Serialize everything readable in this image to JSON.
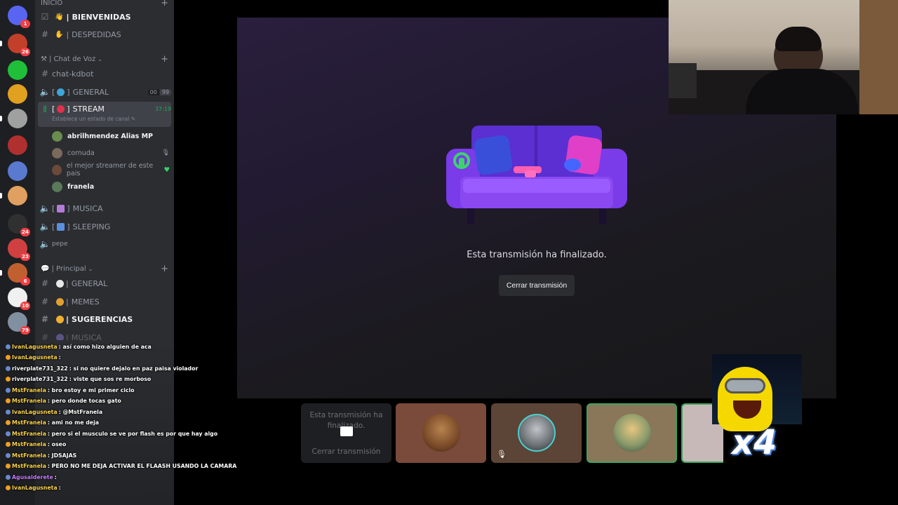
{
  "servers": [
    {
      "badge": "1"
    },
    {
      "badge": "26"
    },
    {
      "badge": ""
    },
    {
      "badge": ""
    },
    {
      "badge": ""
    },
    {
      "badge": ""
    },
    {
      "badge": ""
    },
    {
      "badge": ""
    },
    {
      "badge": "24"
    },
    {
      "badge": "23"
    },
    {
      "badge": "6"
    },
    {
      "badge": "10"
    },
    {
      "badge": "79"
    }
  ],
  "sidebar": {
    "top_cut": "INICIO",
    "channels_top": [
      {
        "emoji": "👋",
        "label": "BIENVENIDAS",
        "icon": "rules-icon",
        "unread": true
      },
      {
        "emoji": "✋",
        "label": "DESPEDIDAS",
        "icon": "hash-icon",
        "unread": false
      }
    ],
    "cat_voz": "Chat de Voz",
    "chat_kdbot": "chat-kdbot",
    "general_voice": {
      "label": "GENERAL",
      "count_a": "00",
      "count_b": "99"
    },
    "stream": {
      "label": "STREAM",
      "time": "37:19",
      "status": "Establece un estado de canal"
    },
    "members": [
      {
        "name": "abrilhmendez Alias MP",
        "bold": true,
        "color": "#6a8e4e"
      },
      {
        "name": "cornuda",
        "bold": false,
        "color": "#7a6a5c"
      },
      {
        "name": "el mejor streamer de este pais",
        "bold": false,
        "color": "#6b4a3a"
      },
      {
        "name": "franela",
        "bold": true,
        "color": "#5a7a5a"
      }
    ],
    "voice_rest": [
      {
        "emoji_color": "#b67ad9",
        "label": "MUSICA"
      },
      {
        "emoji_color": "#5a8fe0",
        "label": "SLEEPING"
      },
      {
        "emoji_color": "",
        "label": "pepe"
      }
    ],
    "cat_principal": "Principal",
    "text_rest": [
      {
        "emoji_color": "#e8e8e8",
        "label": "GENERAL",
        "unread": false
      },
      {
        "emoji_color": "#e0a030",
        "label": "MEMES",
        "unread": false
      },
      {
        "emoji_color": "#f0b030",
        "label": "SUGERENCIAS",
        "unread": true
      },
      {
        "emoji_color": "#8e7ad9",
        "label": "MUSICA",
        "unread": false
      }
    ]
  },
  "stream": {
    "message": "Esta transmisión ha finalizado.",
    "close_label": "Cerrar transmisión"
  },
  "tiles": {
    "ended_text": "Esta transmisión ha finalizado.",
    "ended_close": "Cerrar transmisión",
    "overlay_x": "x4"
  },
  "chat": [
    {
      "user": "IvanLagusneta",
      "color": "#ffd54a",
      "text": ": así como hizo alguien de aca"
    },
    {
      "user": "IvanLagusneta",
      "color": "#ffd54a",
      "text": ":"
    },
    {
      "user": "riverplate731_322",
      "color": "#ffffff",
      "text": ": si no quiere dejalo en paz paisa violador"
    },
    {
      "user": "riverplate731_322",
      "color": "#ffffff",
      "text": ": viste que sos re morboso"
    },
    {
      "user": "MstFranela",
      "color": "#ffd54a",
      "text": ": bro estoy e mi primer ciclo"
    },
    {
      "user": "MstFranela",
      "color": "#ffd54a",
      "text": ": pero donde tocas gato"
    },
    {
      "user": "IvanLagusneta",
      "color": "#ffd54a",
      "text": ": @MstFranela"
    },
    {
      "user": "MstFranela",
      "color": "#ffd54a",
      "text": ": ami no me deja"
    },
    {
      "user": "MstFranela",
      "color": "#ffd54a",
      "text": ": pero si el musculo se ve por flash es por que hay algo"
    },
    {
      "user": "MstFranela",
      "color": "#ffd54a",
      "text": ": oseo"
    },
    {
      "user": "MstFranela",
      "color": "#ffd54a",
      "text": ": JDSAJAS"
    },
    {
      "user": "MstFranela",
      "color": "#ffd54a",
      "text": ": PERO NO ME DEJA ACTIVAR EL FLAASH USANDO LA CAMARA"
    },
    {
      "user": "Agusalderete",
      "color": "#c77dff",
      "text": ":"
    },
    {
      "user": "IvanLagusneta",
      "color": "#ffd54a",
      "text": ":"
    }
  ],
  "colors": {
    "accent": "#5865f2",
    "tile_active_border": "#3ba55d",
    "badge": "#f23f43"
  }
}
